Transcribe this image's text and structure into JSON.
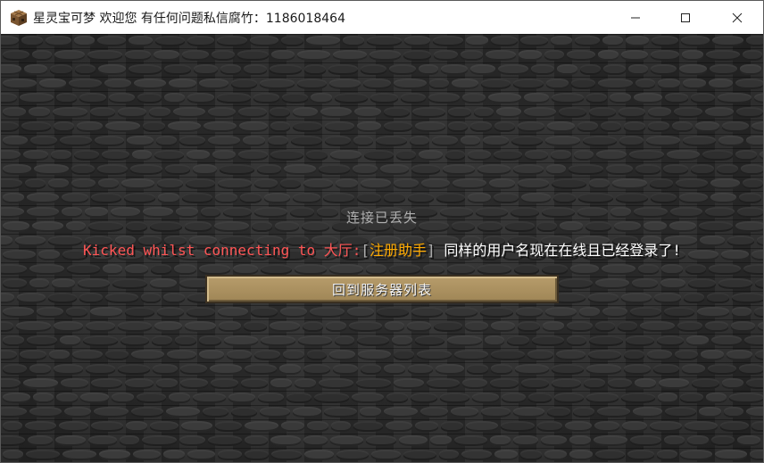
{
  "window": {
    "title": "星灵宝可梦 欢迎您 有任何问题私信腐竹：1186018464",
    "app_icon": "minecraft-crafting-table-icon",
    "controls": {
      "minimize_icon": "minimize-icon",
      "maximize_icon": "maximize-icon",
      "close_icon": "close-icon"
    }
  },
  "screen": {
    "heading": "连接已丢失",
    "kick_message": {
      "part1": "Kicked whilst connecting to ",
      "part2": "大厅:",
      "part3": "[",
      "part4": "注册助手",
      "part5": "]",
      "part6": " 同样的用户名现在在线且已经登录了!"
    },
    "back_button_label": "回到服务器列表"
  },
  "colors": {
    "kick_red": "#ff5555",
    "bracket_gray": "#aaaaaa",
    "gold": "#ffaa00",
    "white": "#ffffff",
    "button_tan": "#a88e5e"
  }
}
